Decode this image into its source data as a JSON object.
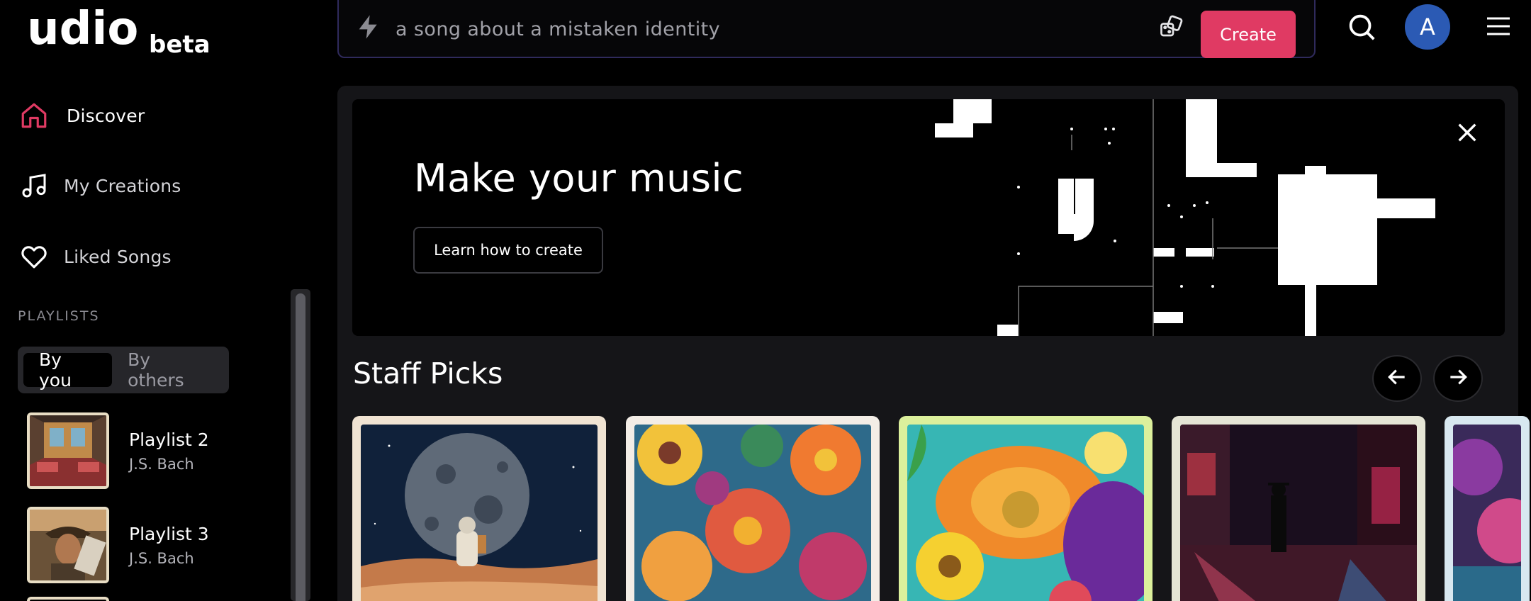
{
  "brand": {
    "logo_word": "udio",
    "logo_badge": "beta"
  },
  "sidebar": {
    "nav": [
      {
        "label": "Discover",
        "icon": "home-icon",
        "active": true
      },
      {
        "label": "My Creations",
        "icon": "music-note-icon",
        "active": false
      },
      {
        "label": "Liked Songs",
        "icon": "heart-icon",
        "active": false
      }
    ],
    "playlists_title": "PLAYLISTS",
    "playlist_filter": {
      "options": [
        "By you",
        "By others"
      ],
      "selected": "By you"
    },
    "playlists": [
      {
        "name": "Playlist 2",
        "author": "J.S. Bach"
      },
      {
        "name": "Playlist 3",
        "author": "J.S. Bach"
      }
    ]
  },
  "topbar": {
    "prompt_placeholder": "a song about a mistaken identity",
    "create_label": "Create",
    "avatar_letter": "A",
    "accent": "#e03a63",
    "avatar_color": "#2b5ab4"
  },
  "hero": {
    "title": "Make your music",
    "button": "Learn how to create"
  },
  "staff_picks": {
    "title": "Staff Picks",
    "cards": [
      {
        "art": "astronaut-on-moon",
        "frame": "#f0e3d2"
      },
      {
        "art": "abstract-flowers",
        "frame": "#f3ede6"
      },
      {
        "art": "vivid-flowers",
        "frame": "#dcf09c"
      },
      {
        "art": "neon-city-rain",
        "frame": "#e5e5d5"
      },
      {
        "art": "psychedelic-partial",
        "frame": "#d8e8f0"
      }
    ]
  }
}
